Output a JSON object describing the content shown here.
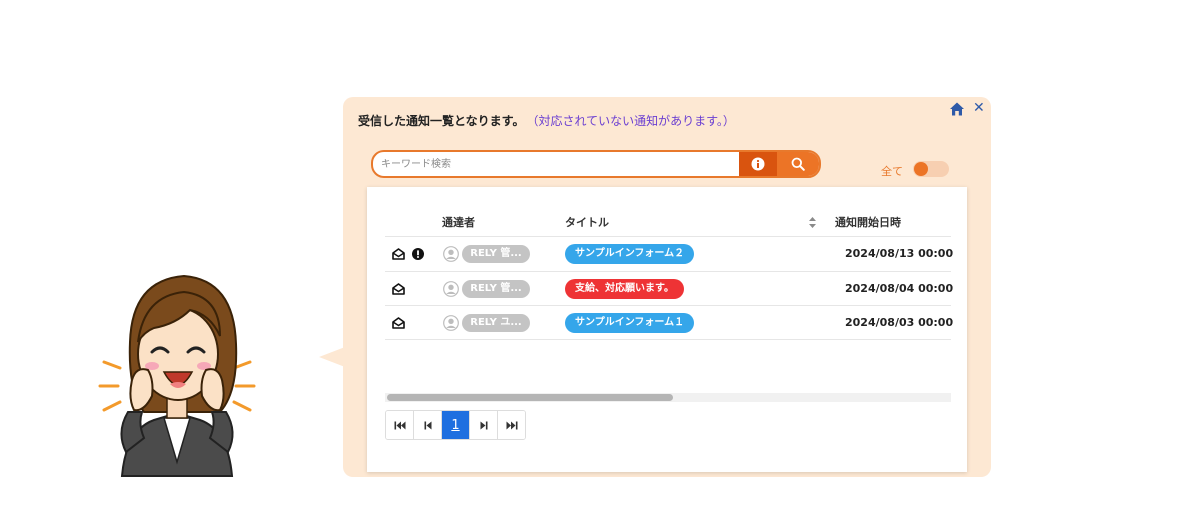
{
  "dialog": {
    "heading": "受信した通知一覧となります。",
    "notice": "（対応されていない通知があります。）",
    "colors": {
      "panel": "#fde8d3",
      "accent": "#ec7426",
      "notice": "#6b3fd1"
    }
  },
  "search": {
    "placeholder": "キーワード検索"
  },
  "filter": {
    "all_label": "全て"
  },
  "table": {
    "headers": {
      "sender": "通達者",
      "title": "タイトル",
      "start_date": "通知開始日時"
    },
    "rows": [
      {
        "sender": "RELY 管...",
        "title": "サンプルインフォーム２",
        "title_color": "#35a6ea",
        "date": "2024/08/13 00:00",
        "alert": true
      },
      {
        "sender": "RELY 管...",
        "title": "支給、対応願います。",
        "title_color": "#ee3335",
        "date": "2024/08/04 00:00",
        "alert": false
      },
      {
        "sender": "RELY ユ...",
        "title": "サンプルインフォーム１",
        "title_color": "#35a6ea",
        "date": "2024/08/03 00:00",
        "alert": false
      }
    ]
  },
  "pagination": {
    "current_page": "1"
  }
}
